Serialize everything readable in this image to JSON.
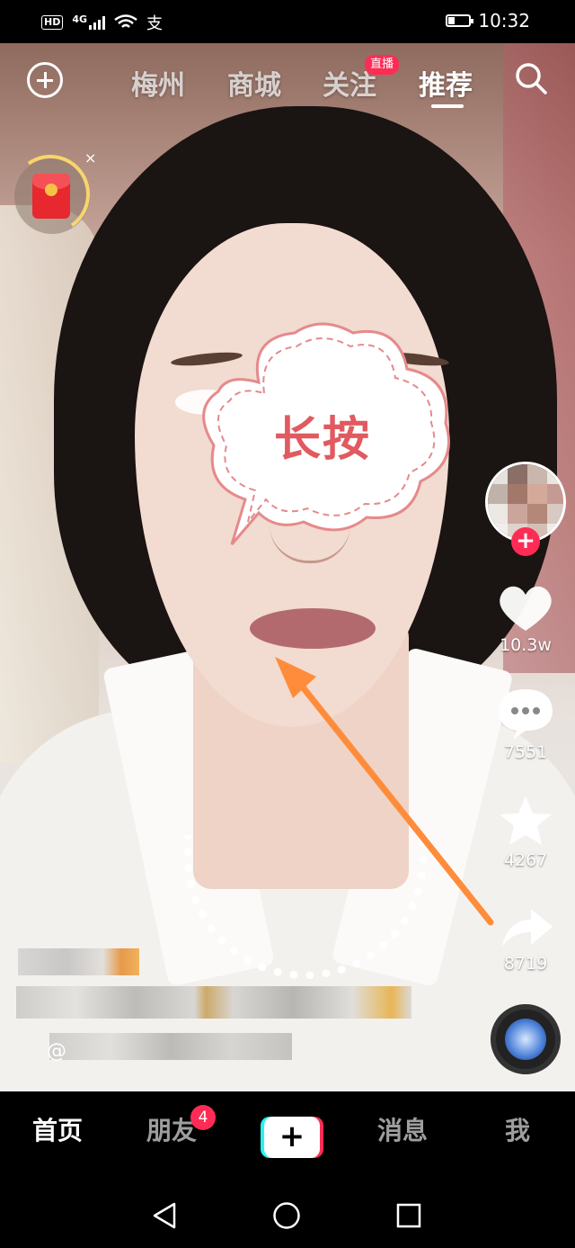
{
  "status_bar": {
    "hd": "HD",
    "network": "4G",
    "alipay": "支",
    "battery_level": 0.3,
    "time": "10:32"
  },
  "top_nav": {
    "tabs": [
      "梅州",
      "商城",
      "关注",
      "推荐"
    ],
    "active_tab": "推荐",
    "live_badge": "直播",
    "icons": [
      "add-circle-icon",
      "search-icon"
    ]
  },
  "overlay": {
    "bubble_text": "长按",
    "redpack_close": "×",
    "arrow_color": "#ff8c3a"
  },
  "right_rail": {
    "follow": "+",
    "likes": "10.3w",
    "comments": "7551",
    "favorites": "4267",
    "shares": "8719"
  },
  "caption": {
    "mention_prefix": "@"
  },
  "bottom_nav": {
    "home": "首页",
    "friends": "朋友",
    "friends_badge": "4",
    "create": "+",
    "messages": "消息",
    "me": "我"
  },
  "colors": {
    "accent": "#fe2c55",
    "cyan": "#25f4ee",
    "bubble_text": "#e05a60"
  }
}
